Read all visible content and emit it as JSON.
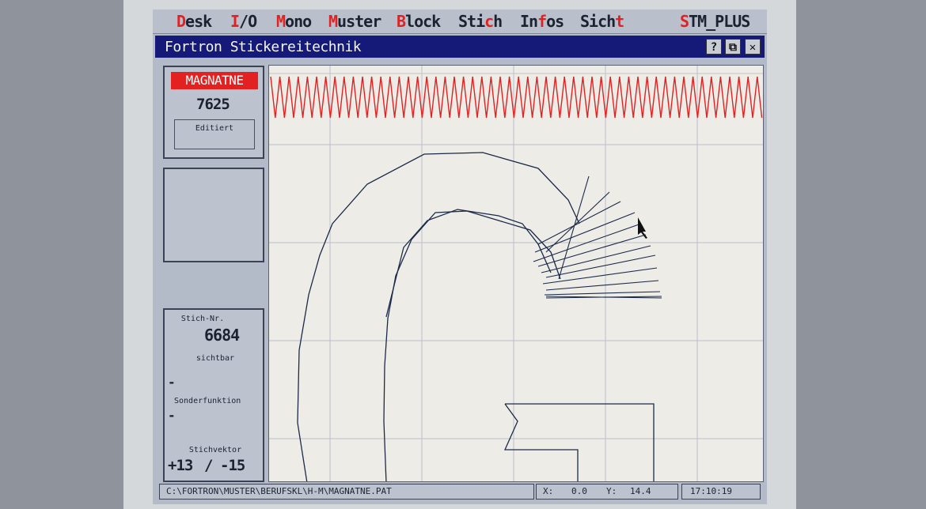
{
  "menu": {
    "items": [
      {
        "hot": "D",
        "rest": "esk"
      },
      {
        "hot": "I",
        "rest": "/O"
      },
      {
        "hot": "M",
        "rest": "ono"
      },
      {
        "hot": "M",
        "rest": "uster"
      },
      {
        "hot": "B",
        "rest": "lock"
      },
      {
        "pre": "Sti",
        "hot": "c",
        "rest": "h"
      },
      {
        "pre": "In",
        "hot": "f",
        "rest": "os"
      },
      {
        "pre": "Sich",
        "hot": "t",
        "rest": ""
      }
    ],
    "app": {
      "hot": "S",
      "rest": "TM_PLUS"
    }
  },
  "window": {
    "title": "Fortron Stickereitechnik",
    "help_label": "?",
    "restore_label": "⧉",
    "close_label": "✕"
  },
  "pattern": {
    "name": "MAGNATNE",
    "number": "7625",
    "status": "Editiert"
  },
  "stitch": {
    "nr_label": "Stich-Nr.",
    "nr_value": "6684",
    "visible_label": "sichtbar",
    "visible_value": "-",
    "special_label": "Sonderfunktion",
    "special_value": "-",
    "vector_label": "Stichvektor",
    "vector_x": "+13",
    "vector_sep": "/",
    "vector_y": "-15"
  },
  "statusbar": {
    "path": "C:\\FORTRON\\MUSTER\\BERUFSKL\\H-M\\MAGNATNE.PAT",
    "x_label": "X:",
    "x_value": "0.0",
    "y_label": "Y:",
    "y_value": "14.4",
    "time": "17:10:19"
  },
  "colors": {
    "accent": "#e22222",
    "titlebar": "#151a78",
    "stitch_line": "#1b2a4a"
  }
}
